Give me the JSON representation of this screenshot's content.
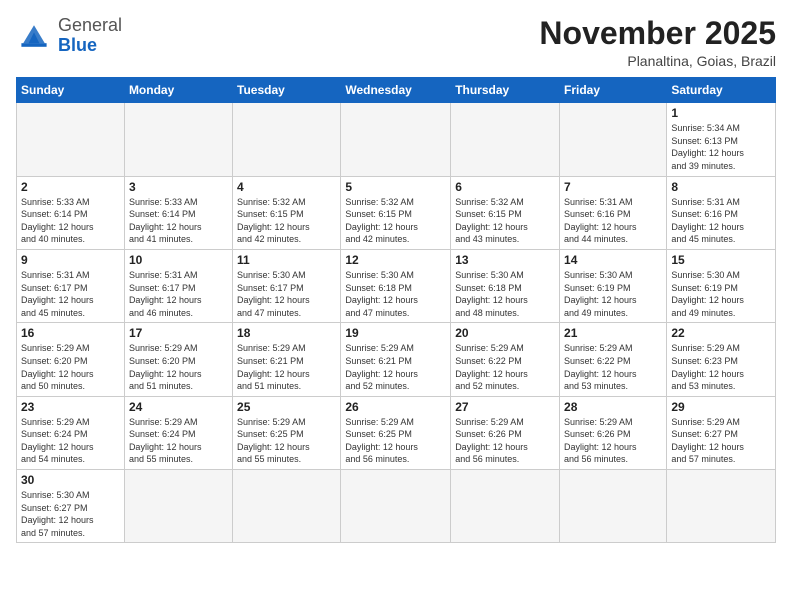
{
  "header": {
    "logo_general": "General",
    "logo_blue": "Blue",
    "month_title": "November 2025",
    "location": "Planaltina, Goias, Brazil"
  },
  "weekdays": [
    "Sunday",
    "Monday",
    "Tuesday",
    "Wednesday",
    "Thursday",
    "Friday",
    "Saturday"
  ],
  "days": [
    {
      "date": "",
      "empty": true
    },
    {
      "date": "",
      "empty": true
    },
    {
      "date": "",
      "empty": true
    },
    {
      "date": "",
      "empty": true
    },
    {
      "date": "",
      "empty": true
    },
    {
      "date": "",
      "empty": true
    },
    {
      "date": "1",
      "sunrise": "5:34 AM",
      "sunset": "6:13 PM",
      "daylight": "12 hours and 39 minutes."
    },
    {
      "date": "2",
      "sunrise": "5:33 AM",
      "sunset": "6:14 PM",
      "daylight": "12 hours and 40 minutes."
    },
    {
      "date": "3",
      "sunrise": "5:33 AM",
      "sunset": "6:14 PM",
      "daylight": "12 hours and 41 minutes."
    },
    {
      "date": "4",
      "sunrise": "5:32 AM",
      "sunset": "6:15 PM",
      "daylight": "12 hours and 42 minutes."
    },
    {
      "date": "5",
      "sunrise": "5:32 AM",
      "sunset": "6:15 PM",
      "daylight": "12 hours and 42 minutes."
    },
    {
      "date": "6",
      "sunrise": "5:32 AM",
      "sunset": "6:15 PM",
      "daylight": "12 hours and 43 minutes."
    },
    {
      "date": "7",
      "sunrise": "5:31 AM",
      "sunset": "6:16 PM",
      "daylight": "12 hours and 44 minutes."
    },
    {
      "date": "8",
      "sunrise": "5:31 AM",
      "sunset": "6:16 PM",
      "daylight": "12 hours and 45 minutes."
    },
    {
      "date": "9",
      "sunrise": "5:31 AM",
      "sunset": "6:17 PM",
      "daylight": "12 hours and 45 minutes."
    },
    {
      "date": "10",
      "sunrise": "5:31 AM",
      "sunset": "6:17 PM",
      "daylight": "12 hours and 46 minutes."
    },
    {
      "date": "11",
      "sunrise": "5:30 AM",
      "sunset": "6:17 PM",
      "daylight": "12 hours and 47 minutes."
    },
    {
      "date": "12",
      "sunrise": "5:30 AM",
      "sunset": "6:18 PM",
      "daylight": "12 hours and 47 minutes."
    },
    {
      "date": "13",
      "sunrise": "5:30 AM",
      "sunset": "6:18 PM",
      "daylight": "12 hours and 48 minutes."
    },
    {
      "date": "14",
      "sunrise": "5:30 AM",
      "sunset": "6:19 PM",
      "daylight": "12 hours and 49 minutes."
    },
    {
      "date": "15",
      "sunrise": "5:30 AM",
      "sunset": "6:19 PM",
      "daylight": "12 hours and 49 minutes."
    },
    {
      "date": "16",
      "sunrise": "5:29 AM",
      "sunset": "6:20 PM",
      "daylight": "12 hours and 50 minutes."
    },
    {
      "date": "17",
      "sunrise": "5:29 AM",
      "sunset": "6:20 PM",
      "daylight": "12 hours and 51 minutes."
    },
    {
      "date": "18",
      "sunrise": "5:29 AM",
      "sunset": "6:21 PM",
      "daylight": "12 hours and 51 minutes."
    },
    {
      "date": "19",
      "sunrise": "5:29 AM",
      "sunset": "6:21 PM",
      "daylight": "12 hours and 52 minutes."
    },
    {
      "date": "20",
      "sunrise": "5:29 AM",
      "sunset": "6:22 PM",
      "daylight": "12 hours and 52 minutes."
    },
    {
      "date": "21",
      "sunrise": "5:29 AM",
      "sunset": "6:22 PM",
      "daylight": "12 hours and 53 minutes."
    },
    {
      "date": "22",
      "sunrise": "5:29 AM",
      "sunset": "6:23 PM",
      "daylight": "12 hours and 53 minutes."
    },
    {
      "date": "23",
      "sunrise": "5:29 AM",
      "sunset": "6:24 PM",
      "daylight": "12 hours and 54 minutes."
    },
    {
      "date": "24",
      "sunrise": "5:29 AM",
      "sunset": "6:24 PM",
      "daylight": "12 hours and 55 minutes."
    },
    {
      "date": "25",
      "sunrise": "5:29 AM",
      "sunset": "6:25 PM",
      "daylight": "12 hours and 55 minutes."
    },
    {
      "date": "26",
      "sunrise": "5:29 AM",
      "sunset": "6:25 PM",
      "daylight": "12 hours and 56 minutes."
    },
    {
      "date": "27",
      "sunrise": "5:29 AM",
      "sunset": "6:26 PM",
      "daylight": "12 hours and 56 minutes."
    },
    {
      "date": "28",
      "sunrise": "5:29 AM",
      "sunset": "6:26 PM",
      "daylight": "12 hours and 56 minutes."
    },
    {
      "date": "29",
      "sunrise": "5:29 AM",
      "sunset": "6:27 PM",
      "daylight": "12 hours and 57 minutes."
    },
    {
      "date": "30",
      "sunrise": "5:30 AM",
      "sunset": "6:27 PM",
      "daylight": "12 hours and 57 minutes."
    }
  ],
  "labels": {
    "sunrise": "Sunrise:",
    "sunset": "Sunset:",
    "daylight": "Daylight:"
  }
}
